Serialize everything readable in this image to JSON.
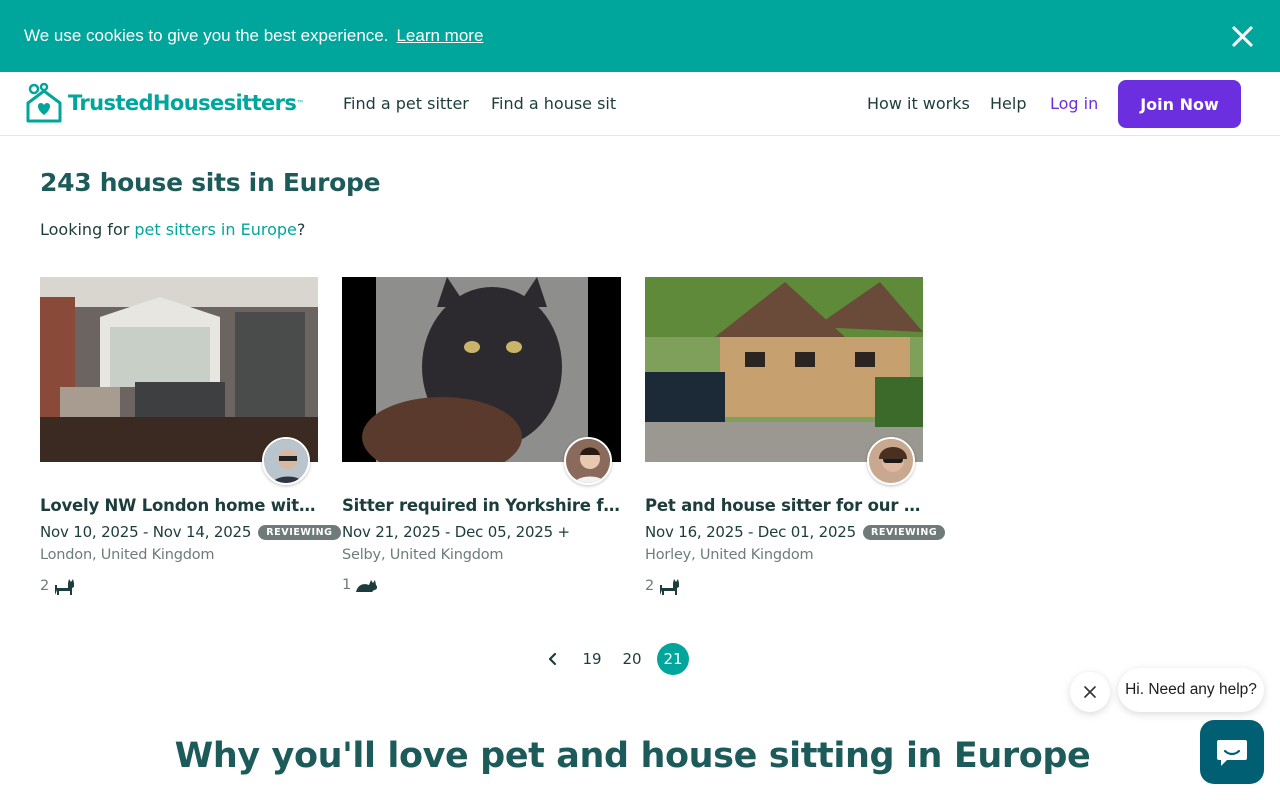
{
  "cookie": {
    "text": "We use cookies to give you the best experience.",
    "link": "Learn more"
  },
  "header": {
    "logo_text": "TrustedHousesitters",
    "nav": {
      "find_pet_sitter": "Find a pet sitter",
      "find_house_sit": "Find a house sit",
      "how_it_works": "How it works",
      "help": "Help",
      "login": "Log in",
      "join": "Join Now"
    }
  },
  "main": {
    "title": "243 house sits in Europe",
    "looking_prefix": "Looking for ",
    "looking_link": "pet sitters in Europe",
    "looking_suffix": "?"
  },
  "listings": [
    {
      "title": "Lovely NW London home with two cats",
      "dates": "Nov 10, 2025 - Nov 14, 2025",
      "badge": "REVIEWING",
      "location": "London, United Kingdom",
      "pet_count": "2",
      "pet_icon": "cat-icon"
    },
    {
      "title": "Sitter required in Yorkshire for lovely cat",
      "dates": "Nov 21, 2025 - Dec 05, 2025 +",
      "badge": "",
      "location": "Selby, United Kingdom",
      "pet_count": "1",
      "pet_icon": "cat-icon"
    },
    {
      "title": "Pet and house sitter for our two cats",
      "dates": "Nov 16, 2025 - Dec 01, 2025",
      "badge": "REVIEWING",
      "location": "Horley, United Kingdom",
      "pet_count": "2",
      "pet_icon": "cat-icon"
    }
  ],
  "pagination": {
    "pages": [
      "19",
      "20",
      "21"
    ],
    "current": "21"
  },
  "why_heading": "Why you'll love pet and house sitting in Europe",
  "chat": {
    "bubble": "Hi. Need any help?"
  },
  "colors": {
    "brand_teal": "#00a69c",
    "brand_purple": "#6b2fe0",
    "heading_teal": "#1d5b5b",
    "chat_button": "#005f73"
  }
}
